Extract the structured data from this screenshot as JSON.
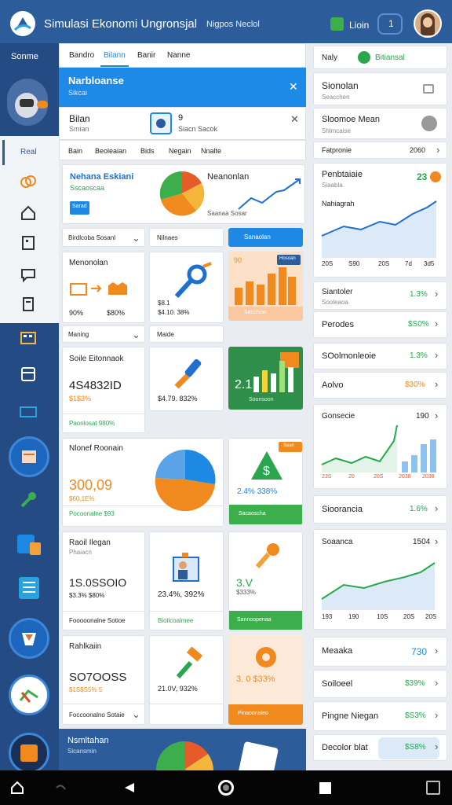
{
  "app": {
    "title": "Simulasi Ekonomi Ungronsjal",
    "subtitle": "Nigpos Neclol",
    "login": "Lioin",
    "badge": "1"
  },
  "sidebar": {
    "header": "Sonme",
    "active": "Real"
  },
  "tabs": [
    "Bandro",
    "Bilann",
    "Banir",
    "Nanne"
  ],
  "blue_banner": {
    "title": "Narbloanse",
    "sub": "Sikcai"
  },
  "search": {
    "title": "Bilan",
    "sub": "Smian",
    "stat1": "9",
    "stat2": "Siacn  Sacok"
  },
  "subtabs": [
    "Bain",
    "Beoleaian",
    "Bids",
    "Negain",
    "Nnalte"
  ],
  "card_a": {
    "title": "Nehana Eskiani",
    "sub": "Sscaoscaa",
    "btn": "Sarad",
    "side_title": "Neanonlan",
    "side_sub": "Saanaa  Sosar"
  },
  "row1": {
    "select": "Birdlcoba Sosanl",
    "mid": "Nilnaes",
    "btn": "Sanaolan"
  },
  "c1": {
    "title": "Menonolan",
    "v1": "90%",
    "v2": "$80%"
  },
  "c2": {
    "v1": "$8.1",
    "v2": "$4.10. 38%"
  },
  "c3": {
    "label": "90",
    "badge": "Hosoan",
    "foot": "Sacohian"
  },
  "row2": {
    "left": "Maning",
    "right": "Maide"
  },
  "c4": {
    "title": "Soile Eitonnaok",
    "value": "4S4832ID",
    "sub": "$1$3%",
    "footer": "Paonlosat 980%"
  },
  "c5": {
    "value": "$4.79. 832%"
  },
  "c6": {
    "label": "2.1",
    "foot": "Soonsoon"
  },
  "c7": {
    "title": "Nlonef Roonain",
    "value": "300,09",
    "sub": "$60,1E%",
    "footer": "Pocoonalne  $93"
  },
  "c9": {
    "badge": "Saan",
    "label": "2.4%  338%",
    "foot": "Sacaoscha"
  },
  "c10": {
    "title": "Raoil Ilegan",
    "sub": "Phaiacn",
    "value": "1S.0SSOIO",
    "sub2": "$3.3%  $80%",
    "footer": "Fooooonalne Sotioe"
  },
  "c11": {
    "value": "23.4%, 392%",
    "foot": "Bioilcoalmee"
  },
  "c12": {
    "label": "3.V",
    "sub": "$333%",
    "foot": "Sannoopenaa"
  },
  "c13": {
    "title": "Rahlkaiin",
    "value": "SO7OOSS",
    "sub": "$1S$S5%  5",
    "footer": "Foccoonalno Sotaie"
  },
  "c14": {
    "value": "21.0V, 932%"
  },
  "c15": {
    "label": "3. 0 $33%",
    "foot": "Pinaoonaleo"
  },
  "bottom": {
    "title": "Nsmltahan",
    "sub": "Sicansmin"
  },
  "right": {
    "tab_left": "Naly",
    "tab_right": "Bitiansal",
    "r1": {
      "title": "Sionolan",
      "sub": "Seacchen"
    },
    "r2": {
      "title": "Sloomoe Mean",
      "sub": "Shlmcaise"
    },
    "r3": {
      "title": "Fatpronie",
      "value": "2060"
    },
    "chart1": {
      "title": "Penbtaiaie",
      "sub": "Siaabla",
      "badge": "23",
      "sub2": "Nahiagrah",
      "x": [
        "20S",
        "S90",
        "20S",
        "7d",
        "3d5"
      ]
    },
    "r4": {
      "title": "Siantoler",
      "sub": "Sooleaoa",
      "value": "1.3%"
    },
    "r5": {
      "title": "Perodes",
      "value": "$S0%"
    },
    "r6": {
      "title": "SOolmonleoie",
      "value": "1.3%"
    },
    "r7": {
      "title": "Aolvo",
      "value": "$30%"
    },
    "chart2": {
      "title": "Gonsecie",
      "value": "190",
      "x": [
        "23S",
        "20",
        "20S",
        "2038",
        "2038"
      ]
    },
    "r8": {
      "title": "Sioorancia",
      "value": "1.6%"
    },
    "chart3": {
      "title": "Soaanca",
      "value": "1504",
      "x": [
        "193",
        "190",
        "10S",
        "20S",
        "20S"
      ]
    },
    "r9": {
      "title": "Meaaka",
      "value": "730"
    },
    "r10": {
      "title": "Soiloeel",
      "value": "$39%"
    },
    "r11": {
      "title": "Pingne Niegan",
      "value": "$S3%"
    },
    "r12": {
      "title": "Decolor blat",
      "value": "$S8%"
    }
  },
  "colors": {
    "primary": "#2d5c9a",
    "banner": "#1e8ae8",
    "green": "#2aa64f",
    "orange": "#f08a1e"
  }
}
